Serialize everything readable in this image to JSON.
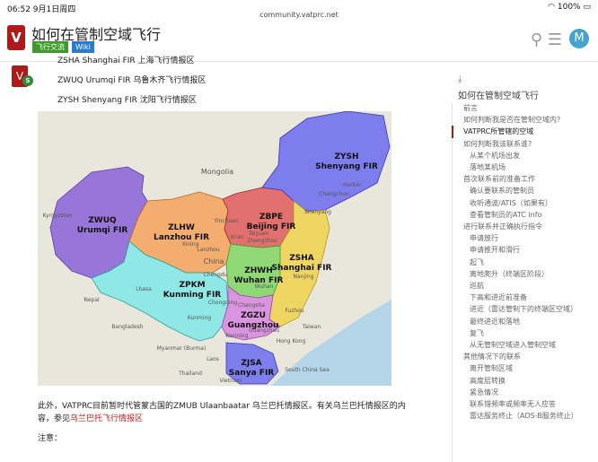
{
  "status_bar": {
    "time": "06:52  9月1日周四",
    "url": "community.vatprc.net",
    "right": "100%"
  },
  "header": {
    "title": "如何在管制空域飞行",
    "tags": [
      "飞行交流",
      "Wiki"
    ],
    "logo_glyph": "V",
    "avatar_letter": "M"
  },
  "post": {
    "avatar_glyph": "V",
    "badge": "S",
    "fir_lines": [
      "ZSHA Shanghai FIR 上海飞行情报区",
      "ZWUQ Urumqi FIR 乌鲁木齐飞行情报区",
      "ZYSH Shenyang FIR 沈阳飞行情报区"
    ],
    "paragraph": "此外，VATPRC目前暂时代管蒙古国的ZMUB Ulaanbaatar 乌兰巴托情报区。有关乌兰巴托情报区的内容，参见",
    "paragraph_link": "乌兰巴托飞行情报区",
    "note": "注意："
  },
  "map": {
    "regions": [
      {
        "code": "ZYSH",
        "name": "Shenyang FIR",
        "color": "#6a6af0"
      },
      {
        "code": "ZWUQ",
        "name": "Urumqi FIR",
        "color": "#8a62d8"
      },
      {
        "code": "ZLHW",
        "name": "Lanzhou FIR",
        "color": "#f3a25c"
      },
      {
        "code": "ZBPE",
        "name": "Beijing FIR",
        "color": "#e05a5a"
      },
      {
        "code": "ZSHA",
        "name": "Shanghai FIR",
        "color": "#efd454"
      },
      {
        "code": "ZHWH",
        "name": "Wuhan FIR",
        "color": "#86d66a"
      },
      {
        "code": "ZPKM",
        "name": "Kunming FIR",
        "color": "#7fe7e6"
      },
      {
        "code": "ZGZU",
        "name": "Guangzhou",
        "color": "#d98be0"
      },
      {
        "code": "ZJSA",
        "name": "Sanya FIR",
        "color": "#6b6bf0"
      }
    ],
    "places": {
      "mongolia": "Mongolia",
      "china": "China",
      "harbin": "Harbin",
      "changchun": "Changchun",
      "shenyang": "Shenyang",
      "lhasa": "Lhasa",
      "chengdu": "Chengdu",
      "chongqing": "Chongqing",
      "kunming": "Kunming",
      "nanning": "Nanning",
      "guangzhou": "Guangzhou",
      "taiwan": "Taiwan",
      "hongkong": "Hong Kong",
      "kyrgyzstan": "Kyrgyzstan",
      "nepal": "Nepal",
      "bangladesh": "Bangladesh",
      "myanmar": "Myanmar (Burma)",
      "laos": "Laos",
      "vietnam": "Vietnam",
      "thailand": "Thailand",
      "southchinasea": "South China Sea",
      "xian": "Xi'an",
      "zhengzhou": "Zhengzhou",
      "wuhan": "Wuhan",
      "changsha": "Changsha",
      "nanjing": "Nanjing",
      "fuzhou": "Fuzhou",
      "taiyuan": "Taiyuan",
      "yinchuan": "Yinchuan",
      "xining": "Xining",
      "lanzhou": "Lanzhou"
    }
  },
  "toc": {
    "title": "如何在管制空域飞行",
    "items": [
      {
        "label": "前言",
        "indent": 1
      },
      {
        "label": "如何判断我是否在管制空域内?",
        "indent": 1
      },
      {
        "label": "VATPRC所管辖的空域",
        "indent": 1,
        "active": true
      },
      {
        "label": "如何判断我该联系谁?",
        "indent": 1
      },
      {
        "label": "从某个机场出发",
        "indent": 2
      },
      {
        "label": "落地某机场",
        "indent": 2
      },
      {
        "label": "首次联系前的准备工作",
        "indent": 1
      },
      {
        "label": "确认要联系的管制员",
        "indent": 2
      },
      {
        "label": "收听通波/ATIS（如果有）",
        "indent": 2
      },
      {
        "label": "查看管制员的ATC info",
        "indent": 2
      },
      {
        "label": "进行联系并正确执行指令",
        "indent": 1
      },
      {
        "label": "申请放行",
        "indent": 2
      },
      {
        "label": "申请推开和滑行",
        "indent": 2
      },
      {
        "label": "起飞",
        "indent": 2
      },
      {
        "label": "离地爬升（终端区阶段）",
        "indent": 2
      },
      {
        "label": "巡航",
        "indent": 2
      },
      {
        "label": "下高和进近前准备",
        "indent": 2
      },
      {
        "label": "进近（雷达管制下的终端区空域）",
        "indent": 2
      },
      {
        "label": "最终进近和落地",
        "indent": 2
      },
      {
        "label": "复飞",
        "indent": 2
      },
      {
        "label": "从无管制空域进入管制空域",
        "indent": 2
      },
      {
        "label": "其他情况下的联系",
        "indent": 1
      },
      {
        "label": "离开管制区域",
        "indent": 2
      },
      {
        "label": "高度层转换",
        "indent": 2
      },
      {
        "label": "紧急情况",
        "indent": 2
      },
      {
        "label": "联系错频率或频率无人应答",
        "indent": 2
      },
      {
        "label": "雷达服务终止（ADS-B服务终止）",
        "indent": 2
      }
    ]
  }
}
